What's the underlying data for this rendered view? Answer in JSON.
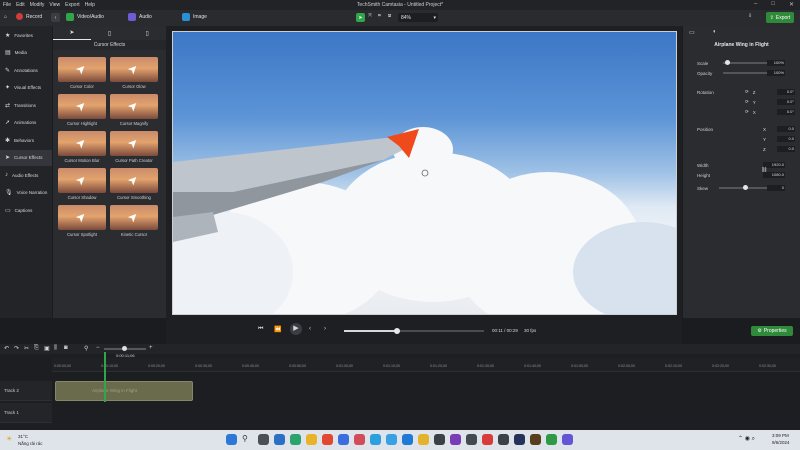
{
  "app": {
    "title": "TechSmith Camtasia - Untitled Project*",
    "menu": [
      "File",
      "Edit",
      "Modify",
      "View",
      "Export",
      "Help"
    ]
  },
  "toolbar": {
    "record_label": "Record",
    "tabs": [
      {
        "label": "Video/Audio",
        "color": "#2fa64a"
      },
      {
        "label": "Audio",
        "color": "#6f5bd6"
      },
      {
        "label": "Image",
        "color": "#2b8fd6"
      }
    ],
    "zoom": "84%",
    "export_label": "Export"
  },
  "sidebar": {
    "items": [
      {
        "label": "Favorites",
        "icon": "star-icon"
      },
      {
        "label": "Media",
        "icon": "media-icon"
      },
      {
        "label": "Annotations",
        "icon": "annotation-icon"
      },
      {
        "label": "Visual Effects",
        "icon": "visual-effects-icon"
      },
      {
        "label": "Transitions",
        "icon": "transitions-icon"
      },
      {
        "label": "Animations",
        "icon": "animations-icon"
      },
      {
        "label": "Behaviors",
        "icon": "behaviors-icon"
      },
      {
        "label": "Cursor Effects",
        "icon": "cursor-icon",
        "active": true
      },
      {
        "label": "Audio Effects",
        "icon": "audio-effects-icon"
      },
      {
        "label": "Voice Narration",
        "icon": "microphone-icon"
      },
      {
        "label": "Captions",
        "icon": "captions-icon"
      }
    ]
  },
  "effects_panel": {
    "header": "Cursor Effects",
    "items": [
      "Cursor Color",
      "Cursor Glow",
      "Cursor Highlight",
      "Cursor Magnify",
      "Cursor Motion Blur",
      "Cursor Path Creator",
      "Cursor Shadow",
      "Cursor Smoothing",
      "Cursor Spotlight",
      "Kinetic Cursor"
    ]
  },
  "properties": {
    "title": "Airplane Wing in Flight",
    "scale_label": "Scale",
    "scale_value": "100%",
    "scale_level": 0.1,
    "opacity_label": "Opacity",
    "opacity_value": "100%",
    "opacity_level": 1.0,
    "rotation_label": "Rotation",
    "rotation": {
      "z": "0.0°",
      "y": "0.0°",
      "x": "0.0°"
    },
    "position_label": "Position",
    "position": {
      "x": "0.0",
      "y": "0.0",
      "z": "0.0"
    },
    "width_label": "Width",
    "width_value": "1920.0",
    "height_label": "Height",
    "height_value": "1080.0",
    "skew_label": "Skew",
    "skew_value": "0",
    "skew_level": 0.5,
    "properties_button": "Properties"
  },
  "playback": {
    "time": "00:11 / 00:29",
    "fps": "30 fps",
    "progress": 0.38
  },
  "timeline": {
    "playhead_time": "0:00:11;06",
    "ticks": [
      "0:00:00;00",
      "0:00:10;00",
      "0:00:20;00",
      "0:00:30;00",
      "0:00:40;00",
      "0:00:50;00",
      "0:01:00;00",
      "0:01:10;00",
      "0:01:20;00",
      "0:01:30;00",
      "0:01:40;00",
      "0:01:50;00",
      "0:02:00;00",
      "0:02:10;00",
      "0:02:20;00",
      "0:02:30;00"
    ],
    "tracks": [
      {
        "name": "Track 2",
        "clip": "Airplane Wing in Flight"
      },
      {
        "name": "Track 1",
        "clip": ""
      }
    ]
  },
  "taskbar": {
    "weather_temp": "31°C",
    "weather_desc": "Nắng rải rác",
    "time": "3:09 PM",
    "date": "9/6/2024"
  }
}
